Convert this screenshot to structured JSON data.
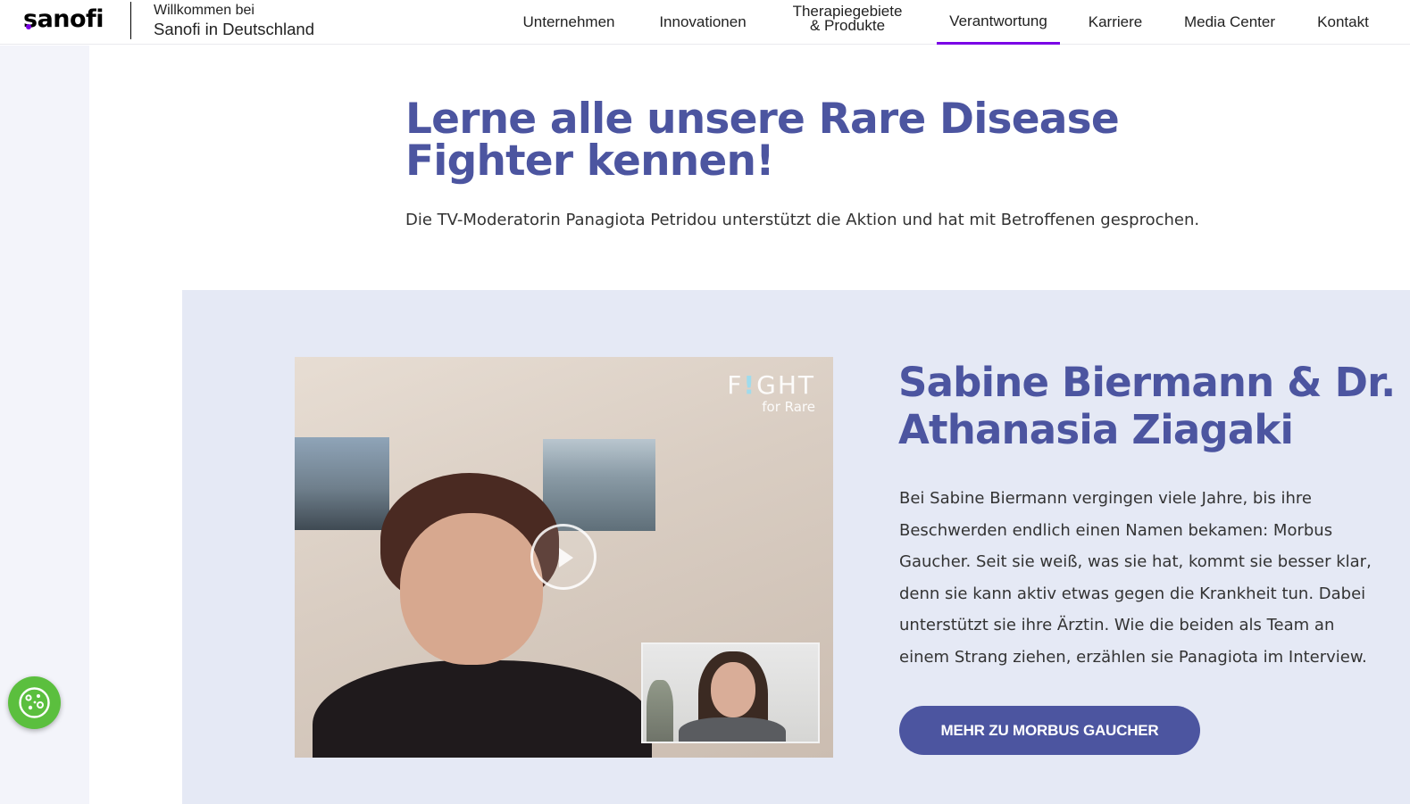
{
  "header": {
    "logo_text": "sanofi",
    "welcome_line1": "Willkommen bei",
    "welcome_line2": "Sanofi in Deutschland",
    "nav": [
      {
        "label": "Unternehmen"
      },
      {
        "label": "Innovationen"
      },
      {
        "label_line1": "Therapiegebiete",
        "label_line2": "& Produkte"
      },
      {
        "label": "Verantwortung",
        "active": true
      },
      {
        "label": "Karriere"
      },
      {
        "label": "Media Center"
      },
      {
        "label": "Kontakt"
      }
    ]
  },
  "intro": {
    "title": "Lerne alle unsere Rare Disease Fighter kennen!",
    "subtitle": "Die TV-Moderatorin Panagiota Petridou unterstützt die Aktion und hat mit Betroffenen gesprochen."
  },
  "feature": {
    "video": {
      "logo_line1_a": "F",
      "logo_line1_b": "!",
      "logo_line1_c": "GHT",
      "logo_line2": "for Rare"
    },
    "title": "Sabine Biermann & Dr. Athanasia Ziagaki",
    "text": "Bei Sabine Biermann vergingen viele Jahre, bis ihre Beschwerden endlich einen Namen bekamen: Morbus Gaucher. Seit sie weiß, was sie hat, kommt sie besser klar, denn sie kann aktiv etwas gegen die Krankheit tun. Dabei unterstützt sie ihre Ärztin. Wie die beiden als Team an einem Strang ziehen, erzählen sie Panagiota im Interview.",
    "cta_label": "MEHR ZU MORBUS GAUCHER"
  },
  "colors": {
    "brand_purple": "#7a00e6",
    "heading_blue": "#4c55a0",
    "band_bg": "#e5e9f5",
    "cookie_green": "#5bbf3e"
  },
  "icons": {
    "cookie": "cookie-icon",
    "play": "play-icon"
  }
}
